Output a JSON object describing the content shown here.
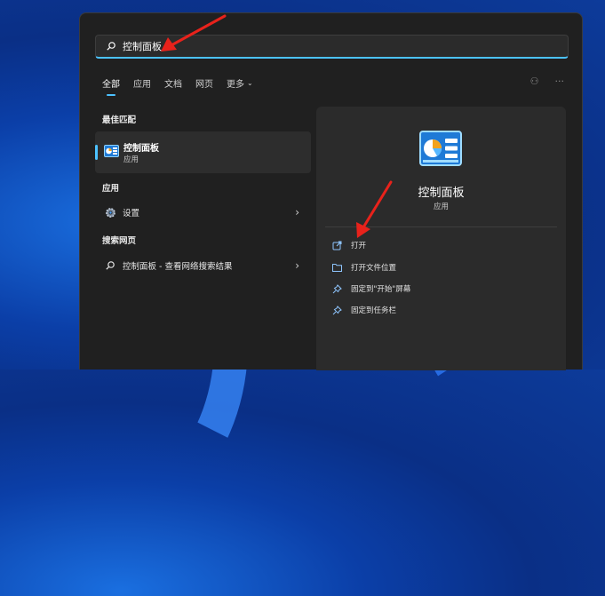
{
  "search": {
    "value": "控制面板"
  },
  "tabs": [
    {
      "label": "全部",
      "active": true
    },
    {
      "label": "应用"
    },
    {
      "label": "文档"
    },
    {
      "label": "网页"
    },
    {
      "label": "更多"
    }
  ],
  "top_icons": [
    "profile-icon",
    "more-options-icon"
  ],
  "best_match": {
    "section_label": "最佳匹配",
    "title": "控制面板",
    "subtitle": "应用",
    "icon": "control-panel-icon"
  },
  "apps": {
    "section_label": "应用",
    "items": [
      {
        "label": "设置",
        "icon": "gear-icon"
      }
    ]
  },
  "web": {
    "section_label": "搜索网页",
    "items": [
      {
        "label": "控制面板 - 查看网络搜索结果",
        "icon": "search-icon"
      }
    ]
  },
  "detail": {
    "title": "控制面板",
    "subtitle": "应用",
    "icon": "control-panel-icon",
    "actions": [
      {
        "label": "打开",
        "icon": "open-icon"
      },
      {
        "label": "打开文件位置",
        "icon": "folder-icon"
      },
      {
        "label": "固定到\"开始\"屏幕",
        "icon": "pin-icon"
      },
      {
        "label": "固定到任务栏",
        "icon": "pin-icon"
      }
    ]
  },
  "colors": {
    "accent": "#4cc2ff",
    "panel_bg": "#202020",
    "annotation_arrow": "#e8221b"
  }
}
